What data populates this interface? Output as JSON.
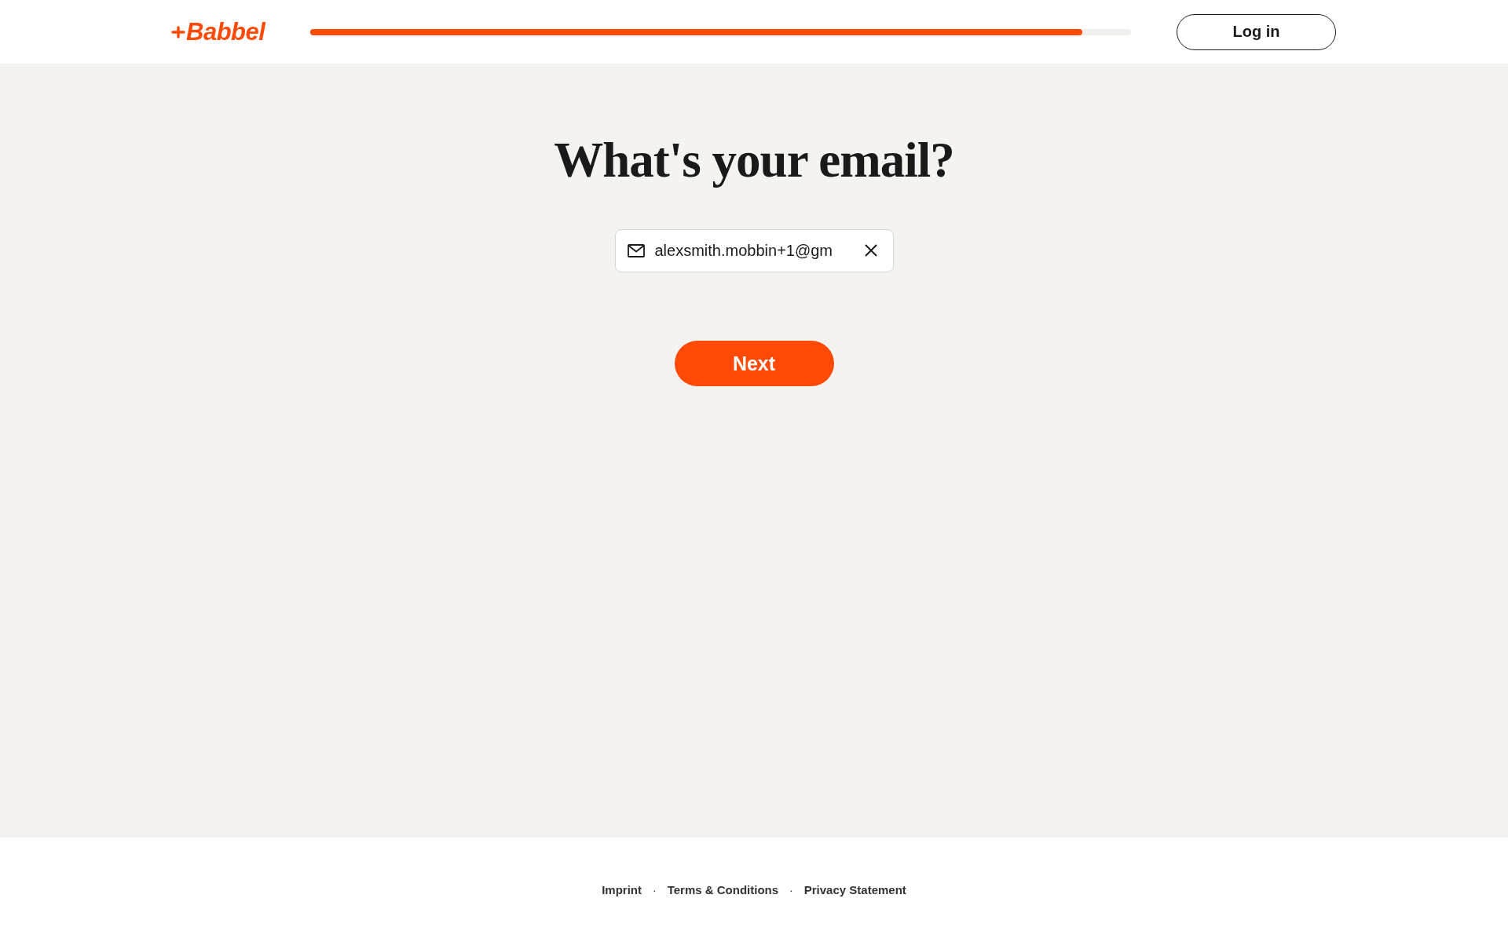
{
  "header": {
    "logo": "Babbel",
    "progress": {
      "level": 0.94
    },
    "login_button": "Log in"
  },
  "title": "What's your email?",
  "email_field": {
    "value": "alexsmith.mobbin+1@gm"
  },
  "next_button": "Next",
  "footer": [
    {
      "kind": "link",
      "text": "Imprint"
    },
    {
      "kind": "separator",
      "text": "·"
    },
    {
      "kind": "link",
      "text": "Terms & Conditions"
    },
    {
      "kind": "separator",
      "text": "·"
    },
    {
      "kind": "link",
      "text": "Privacy Statement"
    }
  ]
}
